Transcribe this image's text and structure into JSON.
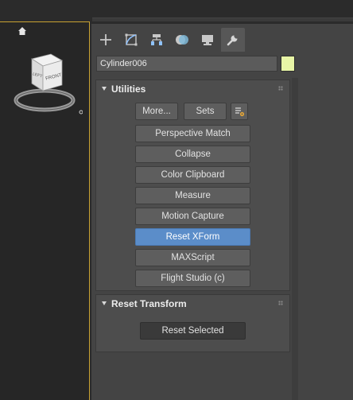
{
  "command_panel": {
    "tabs": [
      {
        "name": "create",
        "icon": "plus-icon"
      },
      {
        "name": "modify",
        "icon": "modify-icon"
      },
      {
        "name": "hierarchy",
        "icon": "hierarchy-icon"
      },
      {
        "name": "motion",
        "icon": "motion-icon"
      },
      {
        "name": "display",
        "icon": "display-icon"
      },
      {
        "name": "utilities",
        "icon": "wrench-icon",
        "active": true
      }
    ],
    "object_name": "Cylinder006",
    "object_color": "#e8f5a6"
  },
  "utilities": {
    "title": "Utilities",
    "more_label": "More...",
    "sets_label": "Sets",
    "items": [
      "Perspective Match",
      "Collapse",
      "Color Clipboard",
      "Measure",
      "Motion Capture",
      "Reset XForm",
      "MAXScript",
      "Flight Studio (c)"
    ],
    "active_item": "Reset XForm"
  },
  "reset_transform": {
    "title": "Reset Transform",
    "button_label": "Reset Selected"
  },
  "viewcube": {
    "face_front": "FRONT",
    "face_left": "LEFT"
  },
  "colors": {
    "accent": "#5b8dc9",
    "viewport_border": "#c8a232",
    "panel_bg": "#444444"
  }
}
